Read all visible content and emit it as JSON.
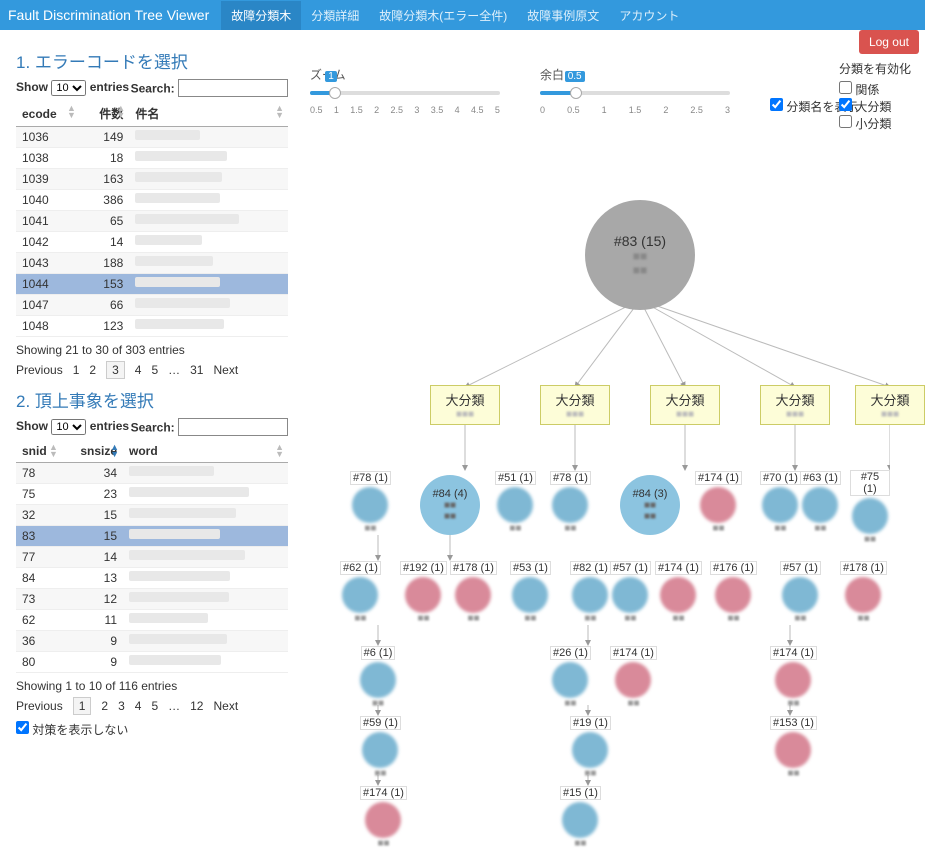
{
  "navbar": {
    "brand": "Fault Discrimination Tree Viewer",
    "items": [
      "故障分類木",
      "分類詳細",
      "故障分類木(エラー全件)",
      "故障事例原文",
      "アカウント"
    ]
  },
  "logout": "Log out",
  "zoom": {
    "label": "ズーム",
    "value": "1",
    "ticks": [
      "0.5",
      "1",
      "1.5",
      "2",
      "2.5",
      "3",
      "3.5",
      "4",
      "4.5",
      "5"
    ]
  },
  "margin": {
    "label": "余白",
    "value": "0.5",
    "ticks": [
      "0",
      "0.5",
      "1",
      "1.5",
      "2",
      "2.5",
      "3"
    ]
  },
  "show_names_label": "分類名を表示",
  "enable": {
    "header": "分類を有効化",
    "opts": [
      "関係",
      "大分類",
      "小分類"
    ]
  },
  "sec1": {
    "title": "1. エラーコードを選択",
    "show": "Show",
    "entries": "entries",
    "search": "Search:",
    "select_opts": [
      "10"
    ],
    "cols": [
      "ecode",
      "件数",
      "件名"
    ],
    "rows": [
      {
        "ecode": "1036",
        "cnt": "149"
      },
      {
        "ecode": "1038",
        "cnt": "18"
      },
      {
        "ecode": "1039",
        "cnt": "163"
      },
      {
        "ecode": "1040",
        "cnt": "386"
      },
      {
        "ecode": "1041",
        "cnt": "65"
      },
      {
        "ecode": "1042",
        "cnt": "14"
      },
      {
        "ecode": "1043",
        "cnt": "188"
      },
      {
        "ecode": "1044",
        "cnt": "153"
      },
      {
        "ecode": "1047",
        "cnt": "66"
      },
      {
        "ecode": "1048",
        "cnt": "123"
      }
    ],
    "selected": 7,
    "info": "Showing 21 to 30 of 303 entries",
    "pager": {
      "prev": "Previous",
      "pages": [
        "1",
        "2",
        "3",
        "4",
        "5",
        "…",
        "31"
      ],
      "current": 2,
      "next": "Next"
    }
  },
  "sec2": {
    "title": "2. 頂上事象を選択",
    "show": "Show",
    "entries": "entries",
    "search": "Search:",
    "select_opts": [
      "10"
    ],
    "cols": [
      "snid",
      "snsize",
      "word"
    ],
    "rows": [
      {
        "snid": "78",
        "sz": "34"
      },
      {
        "snid": "75",
        "sz": "23"
      },
      {
        "snid": "32",
        "sz": "15"
      },
      {
        "snid": "83",
        "sz": "15"
      },
      {
        "snid": "77",
        "sz": "14"
      },
      {
        "snid": "84",
        "sz": "13"
      },
      {
        "snid": "73",
        "sz": "12"
      },
      {
        "snid": "62",
        "sz": "11"
      },
      {
        "snid": "36",
        "sz": "9"
      },
      {
        "snid": "80",
        "sz": "9"
      }
    ],
    "selected": 3,
    "info": "Showing 1 to 10 of 116 entries",
    "pager": {
      "prev": "Previous",
      "pages": [
        "1",
        "2",
        "3",
        "4",
        "5",
        "…",
        "12"
      ],
      "current": 0,
      "next": "Next"
    }
  },
  "hide_measures": "対策を表示しない",
  "tree": {
    "root": "#83 (15)",
    "cat_label": "大分類",
    "row1": [
      {
        "id": "#78 (1)",
        "c": "blue"
      },
      {
        "id": "#84 (4)",
        "big": true
      },
      {
        "id": "#51 (1)",
        "c": "blue"
      },
      {
        "id": "#78 (1)",
        "c": "blue"
      },
      {
        "id": "#84 (3)",
        "big": true
      },
      {
        "id": "#174 (1)",
        "c": "red"
      },
      {
        "id": "#70 (1)",
        "c": "blue"
      },
      {
        "id": "#63 (1)",
        "c": "blue"
      },
      {
        "id": "#75 (1)",
        "c": "blue"
      }
    ],
    "row2": [
      {
        "id": "#62 (1)",
        "c": "blue"
      },
      {
        "id": "#192 (1)",
        "c": "red"
      },
      {
        "id": "#178 (1)",
        "c": "red"
      },
      {
        "id": "#53 (1)",
        "c": "blue"
      },
      {
        "id": "#82 (1)",
        "c": "blue"
      },
      {
        "id": "#57 (1)",
        "c": "blue"
      },
      {
        "id": "#174 (1)",
        "c": "red"
      },
      {
        "id": "#176 (1)",
        "c": "red"
      },
      {
        "id": "#57 (1)",
        "c": "blue"
      },
      {
        "id": "#178 (1)",
        "c": "red"
      }
    ],
    "row3": [
      {
        "id": "#6 (1)",
        "c": "blue"
      },
      {
        "id": "#26 (1)",
        "c": "blue"
      },
      {
        "id": "#174 (1)",
        "c": "red"
      },
      {
        "id": "#174 (1)",
        "c": "red"
      }
    ],
    "row4": [
      {
        "id": "#59 (1)",
        "c": "blue"
      },
      {
        "id": "#19 (1)",
        "c": "blue"
      },
      {
        "id": "#153 (1)",
        "c": "red"
      }
    ],
    "row5": [
      {
        "id": "#174 (1)",
        "c": "red"
      },
      {
        "id": "#15 (1)",
        "c": "blue"
      }
    ]
  }
}
